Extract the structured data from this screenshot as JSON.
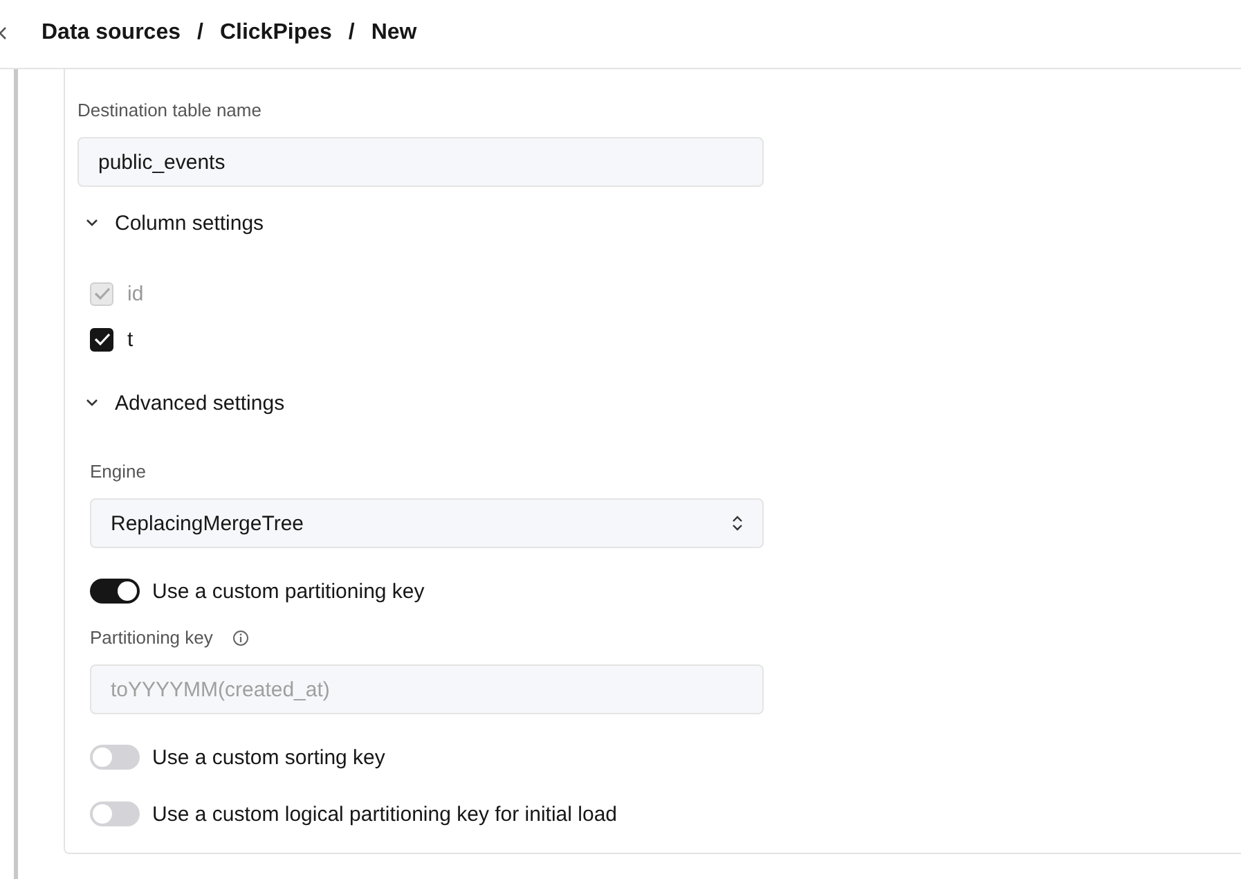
{
  "breadcrumb": {
    "items": [
      {
        "label": "Data sources"
      },
      {
        "label": "ClickPipes"
      },
      {
        "label": "New"
      }
    ],
    "separators": [
      "/",
      "/"
    ]
  },
  "destination": {
    "label": "Destination table name",
    "value": "public_events"
  },
  "column_settings": {
    "title": "Column settings",
    "expanded": true,
    "columns": [
      {
        "name": "id",
        "checked": true,
        "disabled": true
      },
      {
        "name": "t",
        "checked": true,
        "disabled": false
      }
    ]
  },
  "advanced_settings": {
    "title": "Advanced settings",
    "expanded": true,
    "engine": {
      "label": "Engine",
      "value": "ReplacingMergeTree"
    },
    "items": [
      {
        "kind": "toggle",
        "label": "Use a custom partitioning key",
        "on": true
      },
      {
        "kind": "field",
        "label": "Partitioning key",
        "placeholder": "toYYYYMM(created_at)",
        "disabled": true
      },
      {
        "kind": "toggle",
        "label": "Use a custom sorting key",
        "on": false
      },
      {
        "kind": "toggle",
        "label": "Use a custom logical partitioning key for initial load",
        "on": false
      }
    ]
  }
}
